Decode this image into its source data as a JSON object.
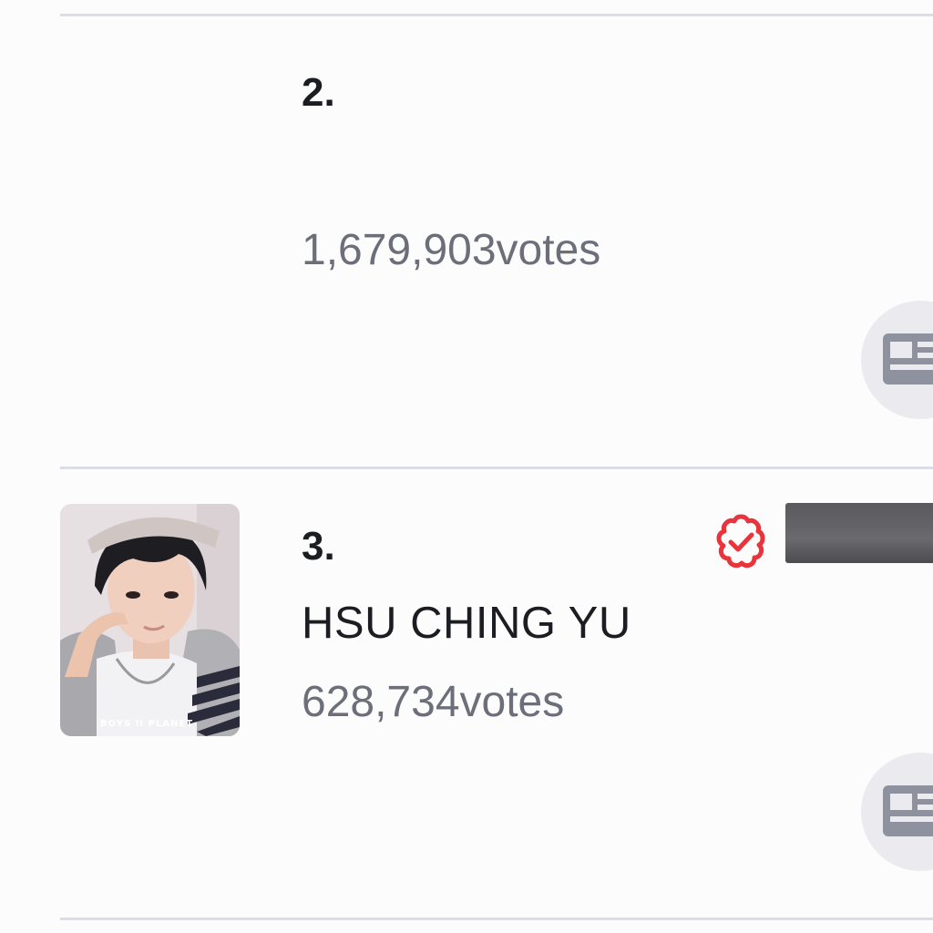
{
  "ranking": [
    {
      "rank": "2.",
      "name": "",
      "votes": "1,679,903votes",
      "news_icon": "news-icon"
    },
    {
      "rank": "3.",
      "name": "HSU CHING YU",
      "votes": "628,734votes",
      "photo_watermark": "BOYS II PLANET",
      "badge_icon": "verified-badge-icon",
      "news_icon": "news-icon"
    }
  ],
  "colors": {
    "badge_red": "#e8353b",
    "divider": "#dcdee5",
    "votes_text": "#6c6e7a",
    "icon_gray": "#8e919e"
  }
}
